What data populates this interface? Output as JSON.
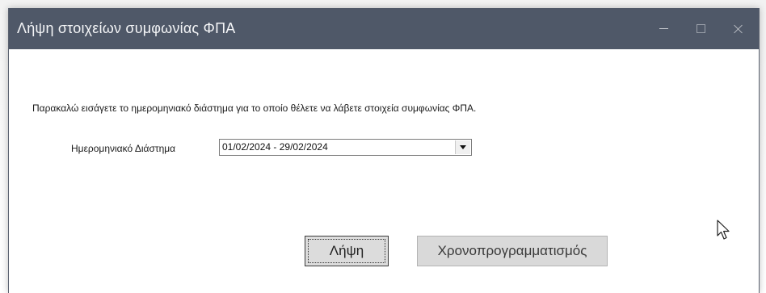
{
  "window": {
    "title": "Λήψη στοιχείων συμφωνίας ΦΠΑ",
    "controls": {
      "minimize_icon": "minimize-icon",
      "maximize_icon": "maximize-icon",
      "close_icon": "close-icon"
    }
  },
  "content": {
    "instruction": "Παρακαλώ εισάγετε το ημερομηνιακό διάστημα για το οποίο θέλετε να λάβετε στοιχεία συμφωνίας ΦΠΑ.",
    "date_range": {
      "label": "Ημερομηνιακό Διάστημα",
      "selected_value": "01/02/2024 - 29/02/2024"
    }
  },
  "buttons": {
    "get_label": "Λήψη",
    "schedule_label": "Χρονοπρογραμματισμός"
  },
  "colors": {
    "titlebar": "#4f5868",
    "title_text": "#f4f5f7",
    "button_face": "#dcdcdc"
  }
}
